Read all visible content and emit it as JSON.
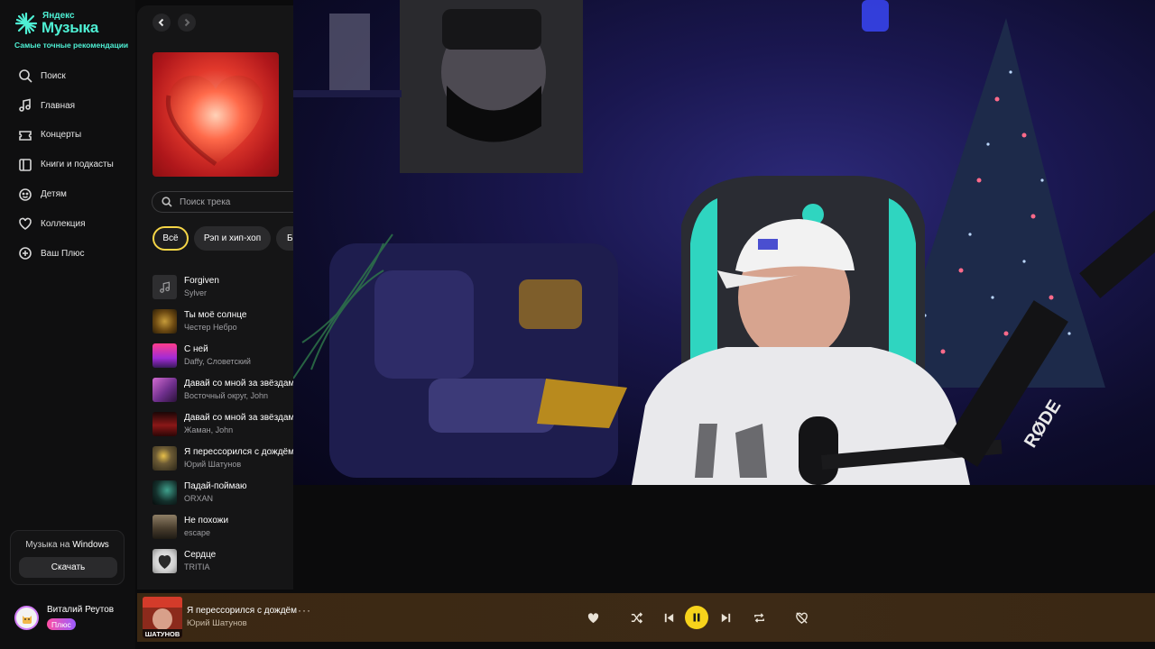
{
  "brand": {
    "small": "Яндекс",
    "big": "Музыка",
    "tagline": "Самые точные рекомендации",
    "accent": "#4ef0d4"
  },
  "nav": {
    "items": [
      {
        "label": "Поиск",
        "icon": "search-icon"
      },
      {
        "label": "Главная",
        "icon": "music-note-icon"
      },
      {
        "label": "Концерты",
        "icon": "ticket-icon"
      },
      {
        "label": "Книги и подкасты",
        "icon": "book-icon"
      },
      {
        "label": "Детям",
        "icon": "kids-icon"
      },
      {
        "label": "Коллекция",
        "icon": "heart-icon"
      },
      {
        "label": "Ваш Плюс",
        "icon": "plus-circle-icon"
      }
    ]
  },
  "download_card": {
    "title_prefix": "Музыка на",
    "title_platform": "Windows",
    "button": "Скачать"
  },
  "user": {
    "name": "Виталий Реутов",
    "badge": "Плюс"
  },
  "content": {
    "search_placeholder": "Поиск трека",
    "filters": [
      "Всё",
      "Рэп и хип-хоп",
      "Б"
    ],
    "active_filter": "Всё",
    "tracks": [
      {
        "title": "Forgiven",
        "artist": "Sylver"
      },
      {
        "title": "Ты моё солнце",
        "artist": "Честер Небро"
      },
      {
        "title": "С ней",
        "artist": "Daffy, Словетский"
      },
      {
        "title": "Давай со мной за звёздами",
        "artist": "Восточный округ, John"
      },
      {
        "title": "Давай со мной за звёздами",
        "artist": "Жаман, John"
      },
      {
        "title": "Я перессорился с дождём",
        "artist": "Юрий Шатунов"
      },
      {
        "title": "Падай-поймаю",
        "artist": "ORXAN"
      },
      {
        "title": "Не похожи",
        "artist": "escape"
      },
      {
        "title": "Сердце",
        "artist": "TRITIA"
      }
    ]
  },
  "player": {
    "title": "Я перессорился с дождём",
    "artist": "Юрий Шатунов",
    "cover_caption": "ШАТУНОВ",
    "more": "···",
    "state": "playing",
    "accent": "#f7d31b"
  },
  "overlay": {
    "mic_brand": "RØDE"
  }
}
